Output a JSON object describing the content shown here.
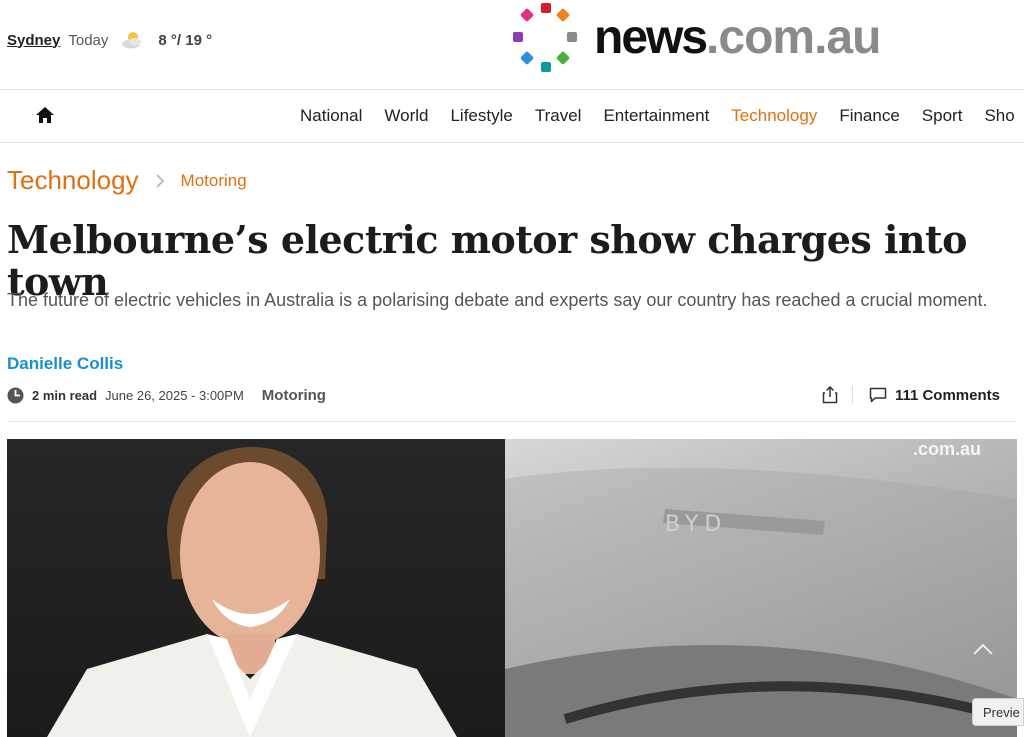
{
  "weather": {
    "city": "Sydney",
    "day": "Today",
    "temps": "8 °/ 19 °",
    "icon": "partly-cloudy-icon"
  },
  "logo": {
    "news": "news",
    "domain": ".com.au"
  },
  "nav": {
    "items": [
      "National",
      "World",
      "Lifestyle",
      "Travel",
      "Entertainment",
      "Technology",
      "Finance",
      "Sport",
      "Sho"
    ],
    "active": "Technology"
  },
  "breadcrumb": {
    "primary": "Technology",
    "secondary": "Motoring"
  },
  "article": {
    "headline": "Melbourne’s electric motor show charges into town",
    "standfirst": "The future of electric vehicles in Australia is a polarising debate and experts say our country has reached a crucial moment.",
    "author": "Danielle Collis",
    "read_time": "2 min read",
    "date": "June 26, 2025 - 3:00PM",
    "section": "Motoring",
    "comments": "111 Comments"
  },
  "video": {
    "watermark": ".com.au"
  },
  "preview_label": "Previe",
  "colors": {
    "accent": "#e07010",
    "author": "#1a8fd0"
  }
}
